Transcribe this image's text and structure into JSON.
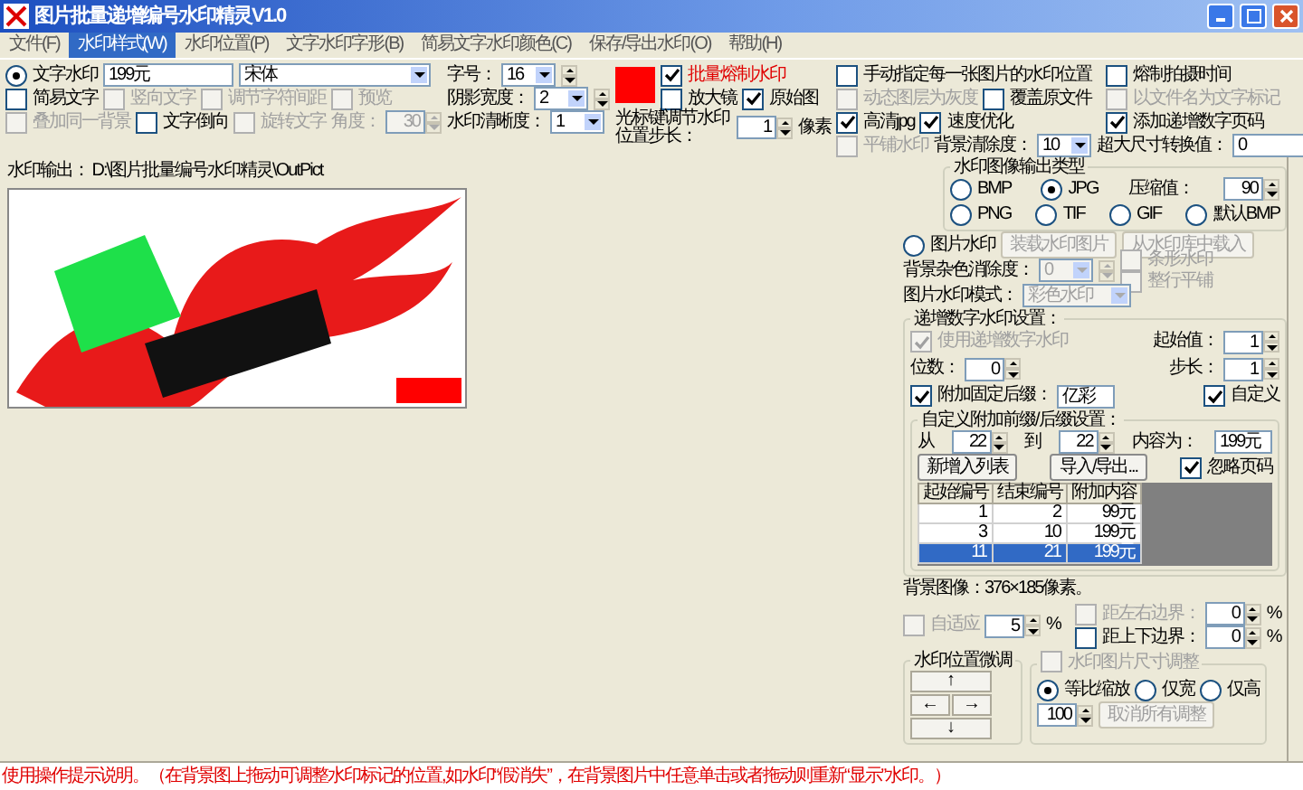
{
  "window": {
    "title": "图片批量递增编号水印精灵V1.0"
  },
  "menu": [
    {
      "label": "文件(F)",
      "selected": false
    },
    {
      "label": "水印样式(W)",
      "selected": true
    },
    {
      "label": "水印位置(P)",
      "selected": false
    },
    {
      "label": "文字水印字形(B)",
      "selected": false
    },
    {
      "label": "简易文字水印颜色(C)",
      "selected": false
    },
    {
      "label": "保存/导出水印(O)",
      "selected": false
    },
    {
      "label": "帮助(H)",
      "selected": false
    }
  ],
  "text_watermark": [
    [
      {
        "kind": "radio",
        "label": "文字水印",
        "selected": true,
        "disabled": false
      },
      {
        "kind": "wide-field",
        "value": "199元",
        "disabled": false
      },
      {
        "kind": "wide-combo",
        "value": "宋体",
        "disabled": false
      }
    ],
    [
      {
        "kind": "check",
        "label": "简易文字",
        "checked": false,
        "disabled": false
      },
      {
        "kind": "check",
        "label": "竖向文字",
        "checked": false,
        "disabled": true
      },
      {
        "kind": "check",
        "label": "调节字符间距",
        "checked": false,
        "disabled": true
      },
      {
        "kind": "check",
        "label": "预览",
        "checked": false,
        "disabled": true
      }
    ],
    [
      {
        "kind": "check",
        "label": "叠加同一背景",
        "checked": false,
        "disabled": true
      },
      {
        "kind": "check",
        "label": "文字倒向",
        "checked": false,
        "disabled": false
      },
      {
        "kind": "check",
        "label": "旋转文字",
        "checked": false,
        "disabled": true
      },
      {
        "kind": "label",
        "label": "角度：",
        "disabled": true
      },
      {
        "kind": "spin",
        "value": "30",
        "disabled": true
      }
    ]
  ],
  "font_settings": [
    [
      {
        "kind": "label",
        "label": "字号：",
        "disabled": false
      },
      {
        "kind": "combo",
        "value": "16",
        "disabled": false
      },
      {
        "kind": "spinner",
        "disabled": false
      }
    ],
    [
      {
        "kind": "label",
        "label": "阴影宽度：",
        "disabled": false
      },
      {
        "kind": "combo",
        "value": "2",
        "disabled": false
      },
      {
        "kind": "spinner",
        "disabled": false
      }
    ],
    [
      {
        "kind": "label",
        "label": "水印清晰度：",
        "disabled": false
      },
      {
        "kind": "combo",
        "value": "1",
        "disabled": false
      }
    ]
  ],
  "color_options": {
    "color": "#ff0000",
    "rows": [
      [
        {
          "kind": "accent-check",
          "label": "批量熔制水印",
          "checked": true,
          "disabled": false
        }
      ],
      [
        {
          "kind": "check",
          "label": "放大镜",
          "checked": false,
          "disabled": false
        },
        {
          "kind": "check",
          "label": "原始图",
          "checked": true,
          "disabled": false
        }
      ]
    ],
    "step_row": [
      {
        "kind": "wrap-label",
        "label": "光标键调节水印位置步长：",
        "disabled": false
      },
      {
        "kind": "spin",
        "value": "1",
        "disabled": false
      },
      {
        "kind": "label",
        "label": "像素",
        "disabled": false
      }
    ]
  },
  "file_options": {
    "rows": [
      {
        "left": [
          {
            "kind": "check",
            "label": "手动指定每一张图片的水印位置",
            "checked": false,
            "disabled": false
          }
        ],
        "right": [
          {
            "kind": "check",
            "label": "熔制拍摄时间",
            "checked": false,
            "disabled": false
          }
        ]
      },
      {
        "left": [
          {
            "kind": "check",
            "label": "动态图层为灰度",
            "checked": false,
            "disabled": true
          },
          {
            "kind": "check",
            "label": "覆盖原文件",
            "checked": false,
            "disabled": false
          }
        ],
        "right": [
          {
            "kind": "check",
            "label": "以文件名为文字标记",
            "checked": false,
            "disabled": true
          }
        ]
      },
      {
        "left": [
          {
            "kind": "check",
            "label": "高清jpg",
            "checked": true,
            "disabled": false
          },
          {
            "kind": "check",
            "label": "速度优化",
            "checked": true,
            "disabled": false
          }
        ],
        "right": [
          {
            "kind": "check",
            "label": "添加递增数字页码",
            "checked": true,
            "disabled": false
          }
        ]
      }
    ],
    "last_row": [
      {
        "kind": "check",
        "label": "平铺水印",
        "checked": false,
        "disabled": true
      },
      {
        "kind": "label",
        "label": "背景清除度：",
        "disabled": false
      },
      {
        "kind": "combo",
        "value": "10",
        "disabled": false
      },
      {
        "kind": "label",
        "label": "超大尺寸转换值：",
        "disabled": false
      },
      {
        "kind": "mid-combo",
        "value": "0",
        "disabled": false
      }
    ]
  },
  "output_path": "水印输出： D:\\图片批量编号水印精灵\\OutPict",
  "output_type": {
    "title": "水印图像输出类型",
    "rows": [
      [
        {
          "kind": "radio",
          "label": "BMP",
          "selected": false,
          "disabled": false
        },
        {
          "kind": "radio",
          "label": "JPG",
          "selected": true,
          "disabled": false
        },
        {
          "kind": "label",
          "label": "压缩值：",
          "disabled": false
        },
        {
          "kind": "spin",
          "value": "90",
          "disabled": false
        }
      ],
      [
        {
          "kind": "radio",
          "label": "PNG",
          "selected": false,
          "disabled": false
        },
        {
          "kind": "radio",
          "label": "TIF",
          "selected": false,
          "disabled": false
        },
        {
          "kind": "radio",
          "label": "GIF",
          "selected": false,
          "disabled": false
        },
        {
          "kind": "radio",
          "label": "默认BMP",
          "selected": false,
          "disabled": false
        }
      ]
    ]
  },
  "image_watermark": [
    [
      {
        "kind": "radio",
        "label": "图片水印",
        "selected": false,
        "disabled": false
      },
      {
        "kind": "button",
        "label": "装载水印图片",
        "disabled": true
      },
      {
        "kind": "button",
        "label": "从水印库中载入",
        "disabled": true
      }
    ],
    [
      {
        "kind": "label",
        "label": "背景杂色消除度：",
        "disabled": false
      },
      {
        "kind": "combo",
        "value": "0",
        "disabled": true
      },
      {
        "kind": "spinner",
        "disabled": true
      },
      {
        "kind": "stack",
        "items": [
          {
            "kind": "check",
            "label": "条形水印",
            "checked": false,
            "disabled": true
          },
          {
            "kind": "check",
            "label": "整行平铺",
            "checked": false,
            "disabled": true
          }
        ]
      }
    ],
    [
      {
        "kind": "label",
        "label": "图片水印模式：",
        "disabled": false
      },
      {
        "kind": "mid-combo",
        "value": "彩色水印",
        "disabled": true
      }
    ]
  ],
  "increment": {
    "title": "递增数字水印设置：",
    "start_row": {
      "left": [
        {
          "kind": "check",
          "label": "使用递增数字水印",
          "checked": true,
          "disabled": true
        }
      ],
      "right": [
        {
          "kind": "label",
          "label": "起始值：",
          "disabled": false
        },
        {
          "kind": "spin",
          "value": "1",
          "disabled": false
        }
      ]
    },
    "digits_row": {
      "left": [
        {
          "kind": "label",
          "label": "位数：",
          "disabled": false
        },
        {
          "kind": "spin",
          "value": "0",
          "disabled": false
        }
      ],
      "right": [
        {
          "kind": "label",
          "label": "步长：",
          "disabled": false
        },
        {
          "kind": "spin",
          "value": "1",
          "disabled": false
        }
      ]
    },
    "suffix_row": {
      "left": [
        {
          "kind": "check",
          "label": "附加固定后缀：",
          "checked": true,
          "disabled": false
        },
        {
          "kind": "field",
          "value": "亿彩",
          "disabled": false
        }
      ],
      "right": [
        {
          "kind": "check",
          "label": "自定义",
          "checked": true,
          "disabled": false
        }
      ]
    },
    "custom": {
      "title": "自定义附加前缀/后缀设置：",
      "range_row": [
        {
          "kind": "label",
          "label": "从",
          "disabled": false
        },
        {
          "kind": "spin",
          "value": "22",
          "disabled": false
        },
        {
          "kind": "label",
          "label": "到",
          "disabled": false
        },
        {
          "kind": "spin",
          "value": "22",
          "disabled": false
        },
        {
          "kind": "label",
          "label": "内容为：",
          "disabled": false
        },
        {
          "kind": "field",
          "value": "199元",
          "disabled": false
        }
      ],
      "actions": [
        {
          "kind": "button",
          "label": "新增入列表",
          "disabled": false
        },
        {
          "kind": "button",
          "label": "导入/导出...",
          "disabled": false
        },
        {
          "kind": "check",
          "label": "忽略页码",
          "checked": true,
          "disabled": false
        }
      ],
      "table": {
        "columns": [
          "起始编号",
          "结束编号",
          "附加内容"
        ],
        "rows": [
          {
            "cells": [
              "1",
              "2",
              "99元"
            ],
            "selected": false
          },
          {
            "cells": [
              "3",
              "10",
              "199元"
            ],
            "selected": false
          },
          {
            "cells": [
              "11",
              "21",
              "199元"
            ],
            "selected": true
          }
        ]
      }
    }
  },
  "image_size": "背景图像：376×185像素。",
  "margins": {
    "adapt": [
      {
        "kind": "check",
        "label": "自适应",
        "checked": false,
        "disabled": true
      },
      {
        "kind": "spin",
        "value": "5",
        "disabled": false
      },
      {
        "kind": "label",
        "label": "%",
        "disabled": false
      }
    ],
    "edges": [
      [
        {
          "kind": "check",
          "label": "距左右边界：",
          "checked": false,
          "disabled": true
        },
        {
          "kind": "spin",
          "value": "0",
          "disabled": false
        },
        {
          "kind": "label",
          "label": "%",
          "disabled": false
        }
      ],
      [
        {
          "kind": "check",
          "label": "距上下边界：",
          "checked": false,
          "disabled": false
        },
        {
          "kind": "spin",
          "value": "0",
          "disabled": false
        },
        {
          "kind": "label",
          "label": "%",
          "disabled": false
        }
      ]
    ]
  },
  "nudge": {
    "title": "水印位置微调",
    "arrows": [
      "↑",
      "←",
      "→",
      "↓"
    ]
  },
  "size_adjust": {
    "toggle": {
      "kind": "check",
      "label": "水印图片尺寸调整",
      "checked": false,
      "disabled": true
    },
    "rows": [
      [
        {
          "kind": "radio",
          "label": "等比缩放",
          "selected": true,
          "disabled": false
        },
        {
          "kind": "radio",
          "label": "仅宽",
          "selected": false,
          "disabled": false
        },
        {
          "kind": "radio",
          "label": "仅高",
          "selected": false,
          "disabled": false
        }
      ],
      [
        {
          "kind": "spin",
          "value": "100",
          "disabled": false
        },
        {
          "kind": "button",
          "label": "取消所有调整",
          "disabled": true
        }
      ]
    ]
  },
  "status": "使用操作提示说明。（在背景图上拖动可调整水印标记的位置,如水印“假消失”，在背景图片中任意单击或者拖动则重新“显示”水印。）"
}
